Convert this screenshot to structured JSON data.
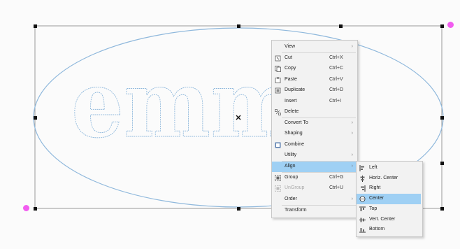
{
  "context_menu": {
    "items": [
      {
        "label": "View",
        "shortcut": "",
        "submenu": true,
        "icon": "",
        "disabled": false
      },
      {
        "label": "Cut",
        "shortcut": "Ctrl+X",
        "submenu": false,
        "icon": "cut-icon",
        "disabled": false
      },
      {
        "label": "Copy",
        "shortcut": "Ctrl+C",
        "submenu": false,
        "icon": "copy-icon",
        "disabled": false
      },
      {
        "label": "Paste",
        "shortcut": "Ctrl+V",
        "submenu": false,
        "icon": "paste-icon",
        "disabled": false
      },
      {
        "label": "Duplicate",
        "shortcut": "Ctrl+D",
        "submenu": false,
        "icon": "duplicate-icon",
        "disabled": false
      },
      {
        "label": "Insert",
        "shortcut": "Ctrl+I",
        "submenu": false,
        "icon": "",
        "disabled": false
      },
      {
        "label": "Delete",
        "shortcut": "",
        "submenu": false,
        "icon": "delete-icon",
        "disabled": false
      },
      {
        "label": "Convert To",
        "shortcut": "",
        "submenu": true,
        "icon": "",
        "disabled": false
      },
      {
        "label": "Shaping",
        "shortcut": "",
        "submenu": true,
        "icon": "",
        "disabled": false
      },
      {
        "label": "Combine",
        "shortcut": "",
        "submenu": false,
        "icon": "combine-icon",
        "disabled": false
      },
      {
        "label": "Utility",
        "shortcut": "",
        "submenu": true,
        "icon": "",
        "disabled": false
      },
      {
        "label": "Align",
        "shortcut": "",
        "submenu": true,
        "icon": "",
        "disabled": false
      },
      {
        "label": "Group",
        "shortcut": "Ctrl+G",
        "submenu": false,
        "icon": "group-icon",
        "disabled": false
      },
      {
        "label": "UnGroup",
        "shortcut": "Ctrl+U",
        "submenu": false,
        "icon": "ungroup-icon",
        "disabled": true
      },
      {
        "label": "Order",
        "shortcut": "",
        "submenu": true,
        "icon": "",
        "disabled": false
      },
      {
        "label": "Transform",
        "shortcut": "",
        "submenu": false,
        "icon": "",
        "disabled": false
      }
    ],
    "highlighted": "Align"
  },
  "align_submenu": {
    "items": [
      {
        "label": "Left",
        "icon": "align-left-icon"
      },
      {
        "label": "Horiz. Center",
        "icon": "align-horiz-center-icon"
      },
      {
        "label": "Right",
        "icon": "align-right-icon"
      },
      {
        "label": "Center",
        "icon": "align-center-icon"
      },
      {
        "label": "Top",
        "icon": "align-top-icon"
      },
      {
        "label": "Vert. Center",
        "icon": "align-vert-center-icon"
      },
      {
        "label": "Bottom",
        "icon": "align-bottom-icon"
      }
    ],
    "highlighted": "Center"
  },
  "canvas": {
    "artwork_text": "emma",
    "outline_color": "#8fb8dc",
    "rotation_handle_color": "#f25cf0",
    "highlight_color": "#9fd0f4"
  }
}
